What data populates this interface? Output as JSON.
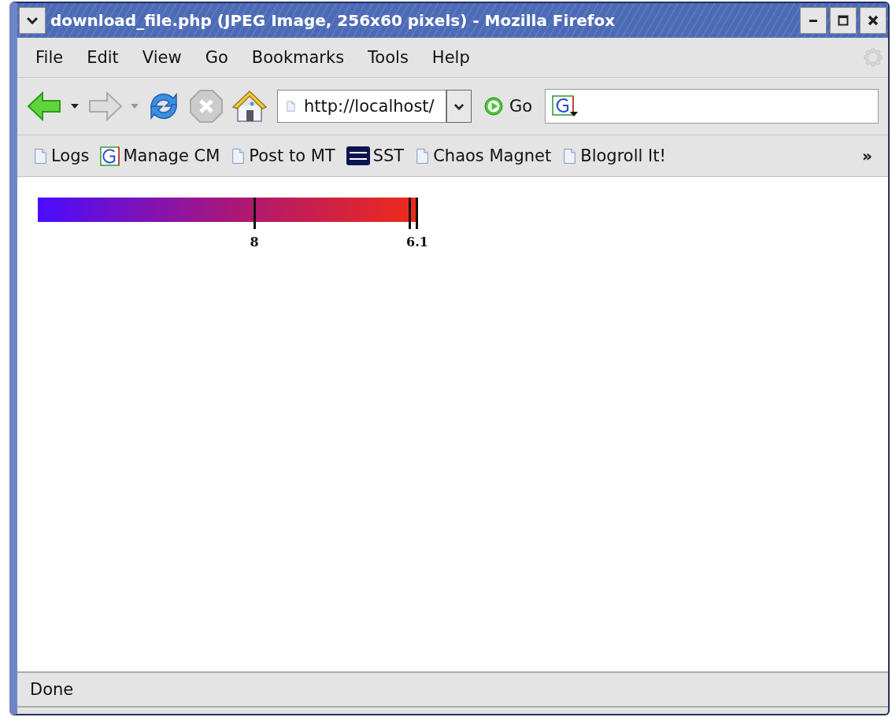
{
  "window": {
    "title": "download_file.php (JPEG Image, 256x60 pixels) - Mozilla Firefox"
  },
  "menu": [
    "File",
    "Edit",
    "View",
    "Go",
    "Bookmarks",
    "Tools",
    "Help"
  ],
  "toolbar": {
    "url": "http://localhost/",
    "go": "Go"
  },
  "bookmarks": [
    {
      "label": "Logs",
      "kind": "page"
    },
    {
      "label": "Manage CM",
      "kind": "google"
    },
    {
      "label": "Post to MT",
      "kind": "page"
    },
    {
      "label": "SST",
      "kind": "sst"
    },
    {
      "label": "Chaos Magnet",
      "kind": "page"
    },
    {
      "label": "Blogroll It!",
      "kind": "page"
    }
  ],
  "bookmarks_more": "»",
  "image": {
    "labels": [
      "8",
      "6.1"
    ]
  },
  "status_bar": "Done"
}
